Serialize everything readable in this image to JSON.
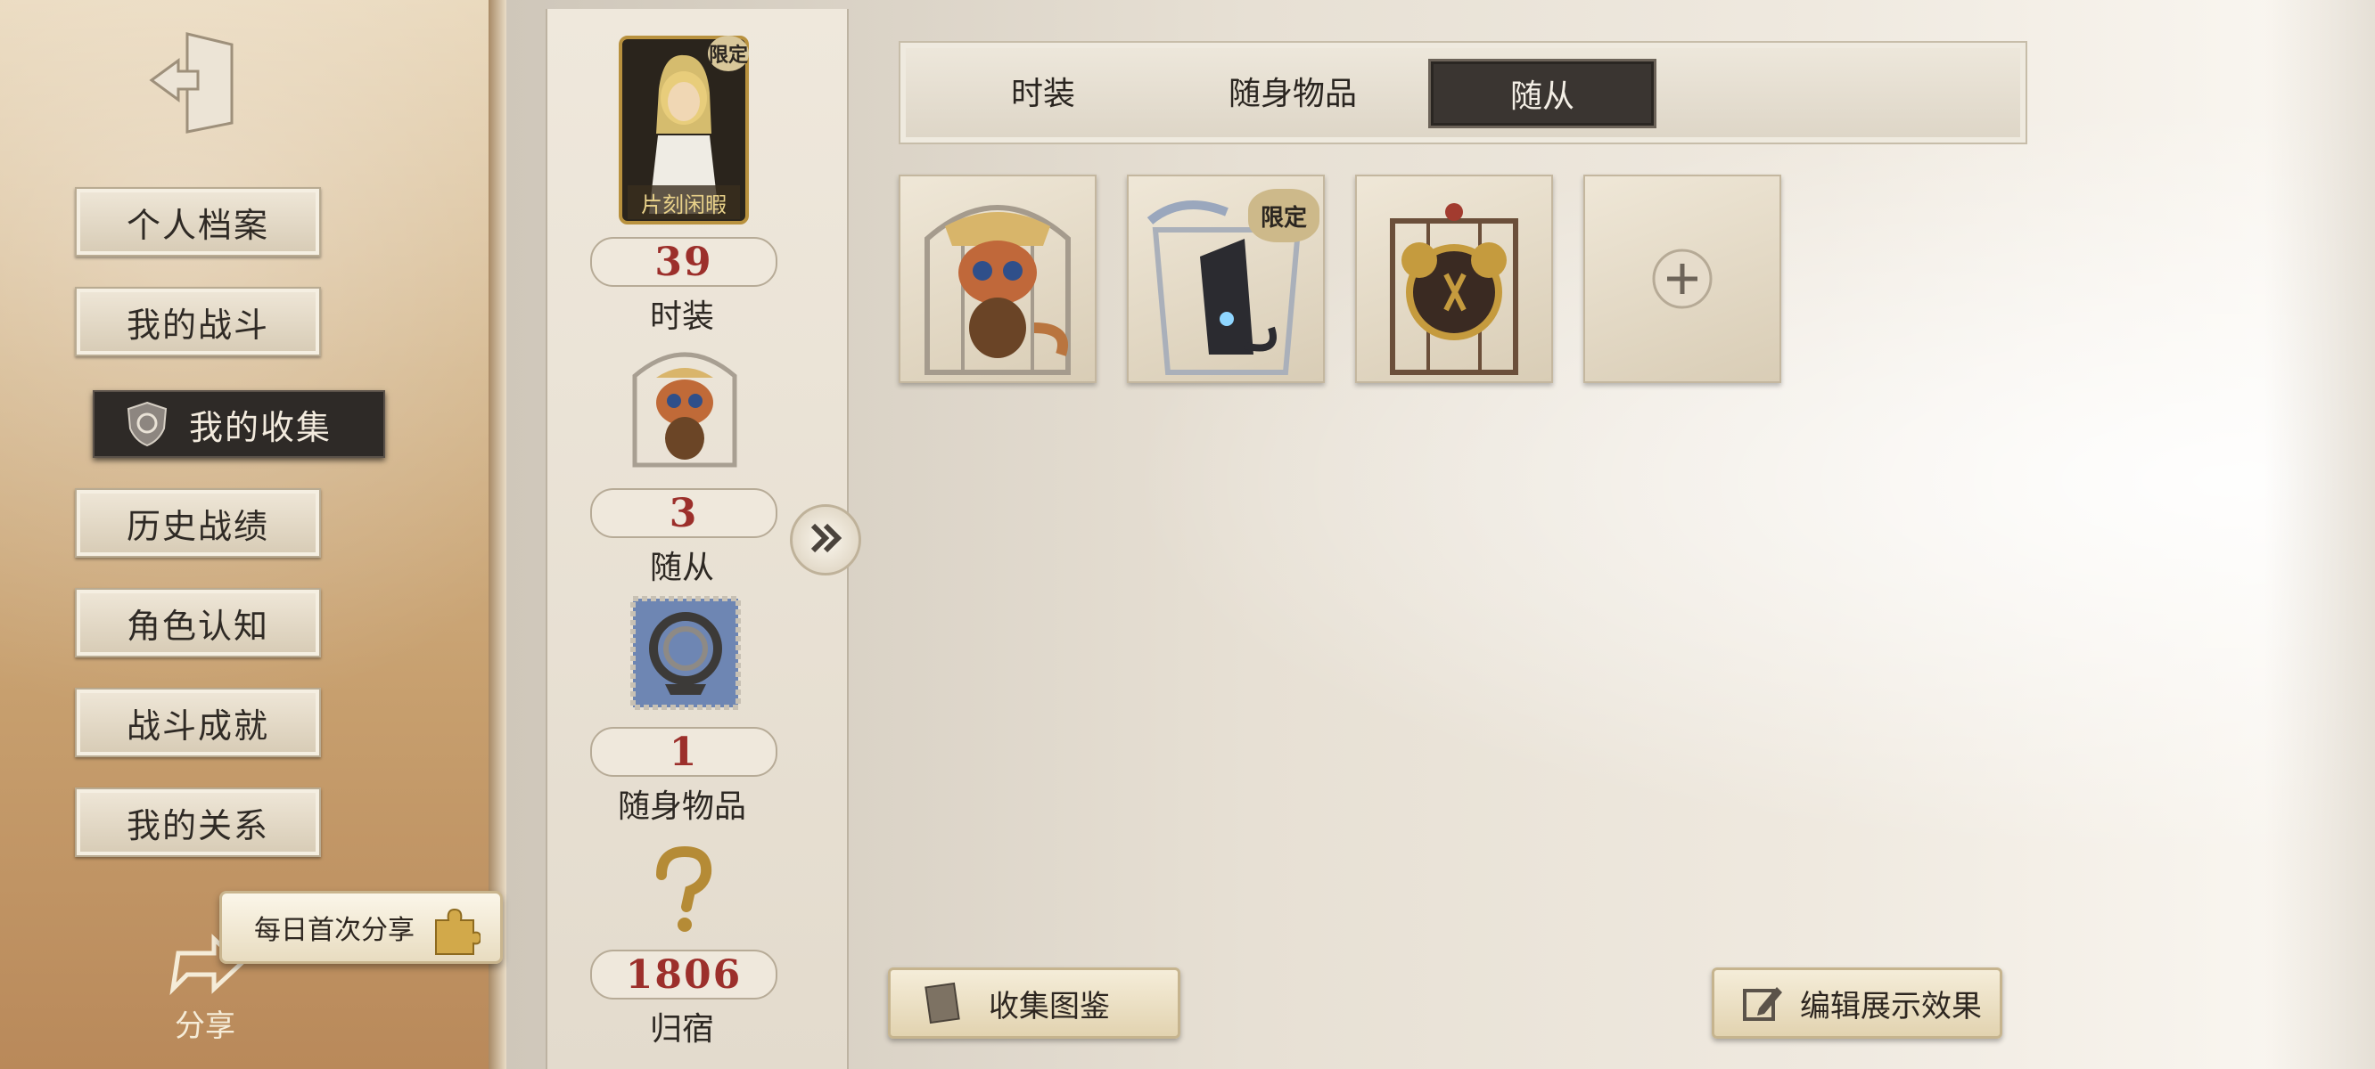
{
  "sidebar": {
    "items": [
      {
        "label": "个人档案"
      },
      {
        "label": "我的战斗"
      },
      {
        "label": "我的收集",
        "active": true
      },
      {
        "label": "历史战绩"
      },
      {
        "label": "角色认知"
      },
      {
        "label": "战斗成就"
      },
      {
        "label": "我的关系"
      }
    ],
    "share_label": "分享",
    "daily_share": "每日首次分享"
  },
  "summary": {
    "costume_badge": "限定",
    "costume_caption": "片刻闲暇",
    "costume_count": "39",
    "costume_label": "时装",
    "companion_count": "3",
    "companion_label": "随从",
    "accessory_count": "1",
    "accessory_label": "随身物品",
    "home_count": "1806",
    "home_label": "归宿"
  },
  "tabs": [
    {
      "label": "时装"
    },
    {
      "label": "随身物品"
    },
    {
      "label": "随从",
      "active": true
    }
  ],
  "grid": {
    "limited_badge": "限定"
  },
  "buttons": {
    "collection_book": "收集图鉴",
    "edit_display": "编辑展示效果"
  },
  "colors": {
    "count_red": "#9c2f2b",
    "active_dark": "#3a3531"
  }
}
